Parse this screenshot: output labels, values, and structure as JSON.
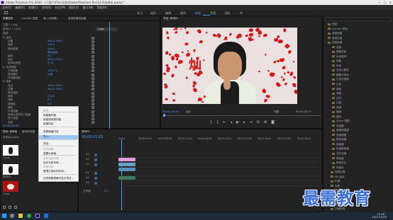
{
  "window": {
    "title": "Adobe Premiere Pro 2020 - C:\\用户\\Film\\文档\\Adobe\\Premiere Pro\\14.0\\未命名.prproj *",
    "controls": [
      "—",
      "□",
      "✕"
    ]
  },
  "menu": [
    "文件(F)",
    "编辑(E)",
    "剪辑(C)",
    "序列(S)",
    "标记(M)",
    "图形(G)",
    "窗口(W)",
    "帮助(H)"
  ],
  "workspaces": [
    "学习",
    "组件",
    "编辑",
    "颜色",
    "效果",
    "音频",
    "图形",
    "库"
  ],
  "workspace_active": "效果",
  "effect_controls": {
    "tabs": [
      "效果控件",
      "Lumetri 范围",
      "源: (无剪辑)",
      "音频剪辑混合器"
    ],
    "header": "主要 * 1.jpg",
    "clip": "序列01 * 1.jpg",
    "clip_label": "1.jpg",
    "section_video": "视频",
    "rows": [
      {
        "label": "fx 运动",
        "value": ""
      },
      {
        "label": "位置",
        "value": "960.0   540.0"
      },
      {
        "label": "缩放",
        "value": "100.0"
      },
      {
        "label": "缩放宽度",
        "value": "100.0"
      },
      {
        "label": "",
        "value": "等比缩放"
      },
      {
        "label": "旋转",
        "value": "0.0"
      },
      {
        "label": "锚点",
        "value": "960.0   540.0"
      },
      {
        "label": "防闪烁滤镜",
        "value": "0.00"
      },
      {
        "label": "fx 不透明度",
        "value": ""
      },
      {
        "label": "不透明度",
        "value": "100.0 %"
      },
      {
        "label": "混合模式",
        "value": "正常"
      },
      {
        "label": "时间重映射",
        "value": ""
      },
      {
        "label": "fx 变换",
        "value": ""
      },
      {
        "label": "锚点",
        "value": "960.0  540.0"
      },
      {
        "label": "位置",
        "value": "960.0  540.0"
      },
      {
        "label": "等比缩放",
        "value": ""
      },
      {
        "label": "缩放",
        "value": "100.0"
      },
      {
        "label": "倾斜",
        "value": "0.0"
      },
      {
        "label": "倾斜轴",
        "value": "0.0"
      },
      {
        "label": "旋转",
        "value": "0.0"
      },
      {
        "label": "不透明度",
        "value": "100.0"
      },
      {
        "label": "使用合成的快门角度",
        "value": ""
      },
      {
        "label": "快门角度",
        "value": "0.00"
      },
      {
        "label": "采样",
        "value": "双线性"
      }
    ],
    "timecode": "00;00;00;00"
  },
  "program": {
    "tab": "节目: 序列01",
    "timecode_left": "00;00;00;00",
    "fit": "适合",
    "quality": "完整",
    "timecode_right": "00;00;02;07",
    "overlay_text": "灿"
  },
  "context_menu": {
    "items": [
      {
        "label": "粘贴",
        "dim": true
      },
      {
        "label": "新建素材箱",
        "dim": false
      },
      {
        "label": "新建搜索素材箱",
        "dim": false
      },
      {
        "label": "新建项目",
        "dim": false
      },
      {
        "label": "查看隐藏内容",
        "dim": false
      },
      {
        "label": "导入...",
        "dim": false,
        "highlight": true
      },
      {
        "label": "查找...",
        "dim": false
      },
      {
        "label": "对齐网格",
        "dim": true
      },
      {
        "label": "重置为网格",
        "dim": false
      },
      {
        "label": "保存当前布局",
        "dim": true
      },
      {
        "label": "另存为新布局...",
        "dim": false
      },
      {
        "label": "恢复布局",
        "dim": true
      },
      {
        "label": "管理已保存的布局...",
        "dim": false
      },
      {
        "label": "在资源管理器中显示项目...",
        "dim": false
      }
    ]
  },
  "project_panel": {
    "tabs": [
      "项目: 未命名",
      "媒体浏览器",
      "库"
    ],
    "name": "未命名.prproj",
    "items": [
      "1.jpg",
      "序列01",
      "2.jpg"
    ]
  },
  "timeline": {
    "tab": "序列01",
    "timecode": "00;00;01;05",
    "ruler": [
      "00;00",
      "00;00;04;00",
      "00;00;08;00",
      "00;00;12;00",
      "00;00;16;00",
      "00;00;20;00",
      "00;00;24;00",
      "00;00;28;00",
      "00;00;32;00",
      "00;00;36;00"
    ],
    "tracks": [
      "V3",
      "V2",
      "V1",
      "A1",
      "A2",
      "A3"
    ],
    "master": "主声道",
    "master_value": "0.0"
  },
  "effects_tree": {
    "items": [
      "预设",
      "Lumetri 预设",
      "音频效果",
      "音频过渡",
      "视频效果",
      "变换",
      "图像控制",
      "实用程序",
      "扭曲",
      "时间",
      "杂色与颗粒",
      "模糊与锐化",
      "沉浸式视频",
      "生成",
      "视频",
      "调整",
      "过时",
      "过渡",
      "透视",
      "通道",
      "键控",
      "Alpha 调整",
      "亮度键",
      "图像遮罩键",
      "差值遮罩",
      "移除遮罩",
      "超级键",
      "轨道遮罩键",
      "非红色键",
      "颜色键",
      "颜色校正",
      "风格化",
      "视频过渡",
      "3D 运动",
      "内滑",
      "划像",
      "擦除",
      "沉浸式视频",
      "溶解",
      "缩放",
      "页面剥落"
    ]
  },
  "taskbar": {
    "time": "13:48",
    "date": "2021/10/24"
  },
  "watermark": "最需教育"
}
